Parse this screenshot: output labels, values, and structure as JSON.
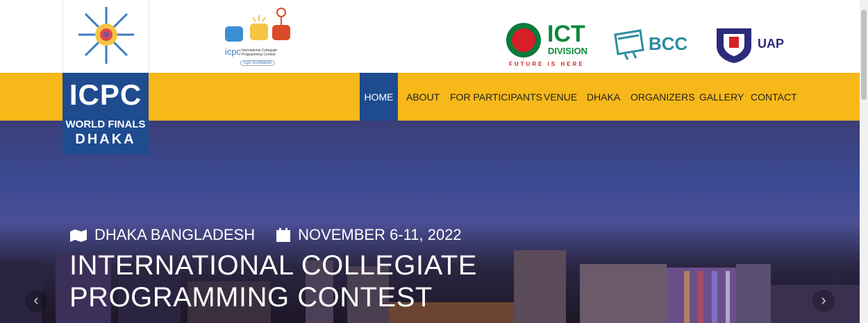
{
  "header": {
    "logo": {
      "title": "ICPC",
      "line2": "WORLD FINALS",
      "line3": "DHAKA"
    },
    "icpc_foundation": {
      "name": "icpc",
      "subtitle": "International Collegiate Programming Contest",
      "pill": "icpc.foundation"
    },
    "ict": {
      "title": "ICT",
      "division": "DIVISION",
      "tagline": "FUTURE IS HERE"
    },
    "bcc": {
      "name": "BCC"
    },
    "uap": {
      "name": "UAP"
    }
  },
  "nav": {
    "items": [
      {
        "label": "HOME",
        "active": true
      },
      {
        "label": "ABOUT"
      },
      {
        "label": "FOR PARTICIPANTS"
      },
      {
        "label": "VENUE"
      },
      {
        "label": "DHAKA"
      },
      {
        "label": "ORGANIZERS"
      },
      {
        "label": "GALLERY"
      },
      {
        "label": "CONTACT"
      }
    ]
  },
  "hero": {
    "location": "DHAKA BANGLADESH",
    "dates": "NOVEMBER 6-11, 2022",
    "title_line1": "INTERNATIONAL COLLEGIATE",
    "title_line2": "PROGRAMMING CONTEST",
    "prev": "‹",
    "next": "›"
  },
  "colors": {
    "nav_bg": "#f7b81a",
    "active_bg": "#1f4b8f",
    "ict_green": "#0a8a3a",
    "ict_red": "#d61f26"
  }
}
